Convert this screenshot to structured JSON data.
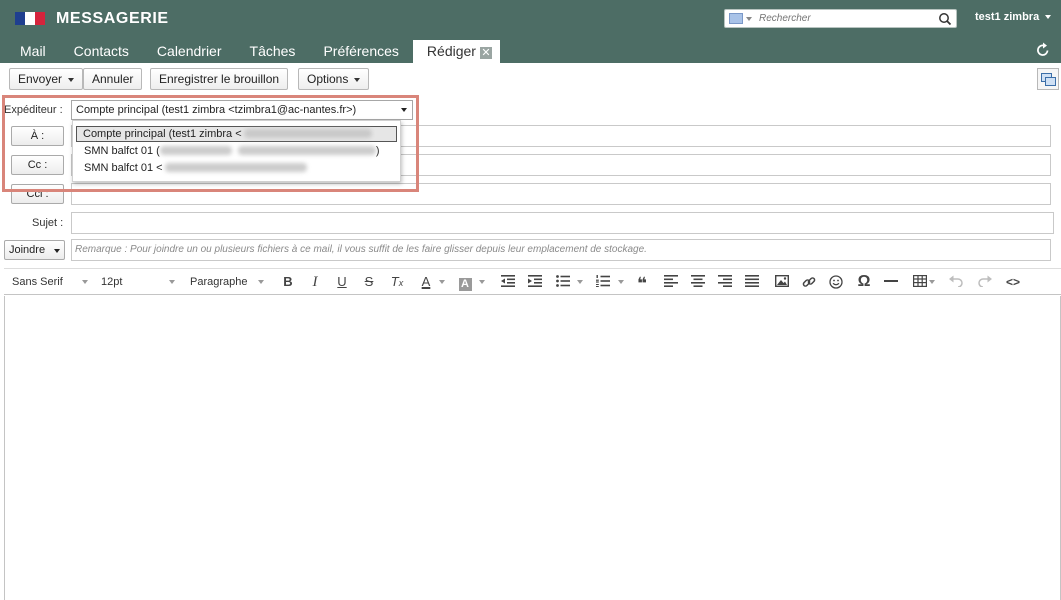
{
  "header": {
    "app_title": "MESSAGERIE",
    "search_placeholder": "Rechercher",
    "user_name": "test1 zimbra"
  },
  "tabs": [
    {
      "label": "Mail"
    },
    {
      "label": "Contacts"
    },
    {
      "label": "Calendrier"
    },
    {
      "label": "Tâches"
    },
    {
      "label": "Préférences"
    },
    {
      "label": "Rédiger",
      "active": true,
      "closable": true
    }
  ],
  "toolbar": {
    "send_label": "Envoyer",
    "cancel_label": "Annuler",
    "save_draft_label": "Enregistrer le brouillon",
    "options_label": "Options"
  },
  "compose": {
    "from_label": "Expéditeur :",
    "from_value": "Compte principal (test1 zimbra <tzimbra1@ac-nantes.fr>)",
    "from_options": [
      {
        "label": "Compte principal (test1 zimbra <",
        "tail": "",
        "selected": true
      },
      {
        "label": "SMN balfct 01 (",
        "tail": ")",
        "selected": false
      },
      {
        "label": "SMN balfct 01 <",
        "tail": "",
        "selected": false
      }
    ],
    "to_label": "À :",
    "cc_label": "Cc :",
    "bcc_label": "Cci :",
    "subject_label": "Sujet :",
    "attach_label": "Joindre",
    "attach_hint": "Remarque : Pour joindre un ou plusieurs fichiers à ce mail, il vous suffit de les faire glisser depuis leur emplacement de stockage."
  },
  "editor": {
    "font_family": "Sans Serif",
    "font_size": "12pt",
    "block_format": "Paragraphe"
  },
  "colors": {
    "header_bg": "#4d6d65",
    "highlight_border": "#d9857a"
  }
}
